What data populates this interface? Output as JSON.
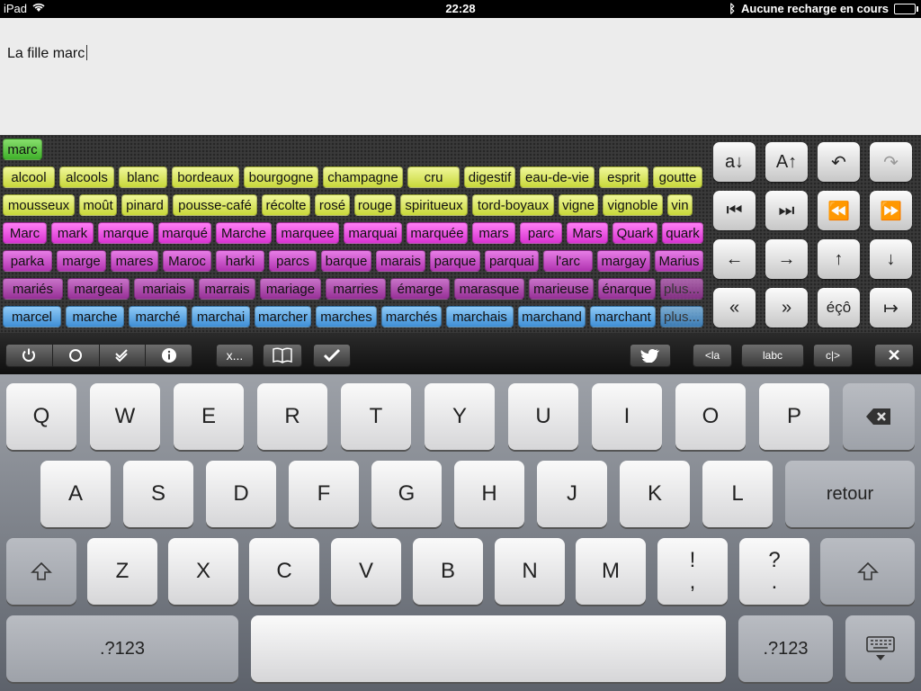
{
  "status": {
    "carrier": "iPad",
    "time": "22:28",
    "battery_text": "Aucune recharge en cours"
  },
  "editor": {
    "text": "La fille marc"
  },
  "suggestions": {
    "row0": [
      "marc"
    ],
    "row1": [
      "alcool",
      "alcools",
      "blanc",
      "bordeaux",
      "bourgogne",
      "champagne",
      "cru",
      "digestif",
      "eau-de-vie",
      "esprit",
      "goutte"
    ],
    "row2": [
      "mousseux",
      "moût",
      "pinard",
      "pousse-café",
      "récolte",
      "rosé",
      "rouge",
      "spiritueux",
      "tord-boyaux",
      "vigne",
      "vignoble",
      "vin"
    ],
    "row3": [
      "Marc",
      "mark",
      "marque",
      "marqué",
      "Marche",
      "marquee",
      "marquai",
      "marquée",
      "mars",
      "parc",
      "Mars",
      "Quark",
      "quark"
    ],
    "row4": [
      "parka",
      "marge",
      "mares",
      "Maroc",
      "harki",
      "parcs",
      "barque",
      "marais",
      "parque",
      "parquai",
      "l'arc",
      "margay",
      "Marius"
    ],
    "row5": [
      "mariés",
      "margeai",
      "mariais",
      "marrais",
      "mariage",
      "marries",
      "émarge",
      "marasque",
      "marieuse",
      "énarque",
      "plus..."
    ],
    "row6": [
      "marcel",
      "marche",
      "marché",
      "marchai",
      "marcher",
      "marches",
      "marchés",
      "marchais",
      "marchand",
      "marchant",
      "plus..."
    ]
  },
  "tools": {
    "r0": [
      "a↓",
      "A↑",
      "↶",
      "↷"
    ],
    "r1": [
      "⏮",
      "⏭",
      "⏪",
      "⏩"
    ],
    "r2": [
      "←",
      "→",
      "↑",
      "↓"
    ],
    "r3": [
      "«",
      "»",
      "éçô",
      "↦"
    ]
  },
  "toolbar": {
    "ellipsis": "x...",
    "left_label": "<la",
    "mid_label": "labc",
    "right_label": "c|>",
    "close": "✕"
  },
  "keyboard": {
    "row1": [
      "Q",
      "W",
      "E",
      "R",
      "T",
      "Y",
      "U",
      "I",
      "O",
      "P"
    ],
    "row2": [
      "A",
      "S",
      "D",
      "F",
      "G",
      "H",
      "J",
      "K",
      "L"
    ],
    "row3": [
      "Z",
      "X",
      "C",
      "V",
      "B",
      "N",
      "M"
    ],
    "return_label": "retour",
    "num_label": ".?123",
    "excl": [
      "!",
      ","
    ],
    "quest": [
      "?",
      "."
    ]
  },
  "colors": {
    "green": "#4cc135",
    "yellow": "#d5e24c",
    "magenta": "#e342dd",
    "purple": "#a53aa5",
    "blue": "#4a98dc"
  }
}
